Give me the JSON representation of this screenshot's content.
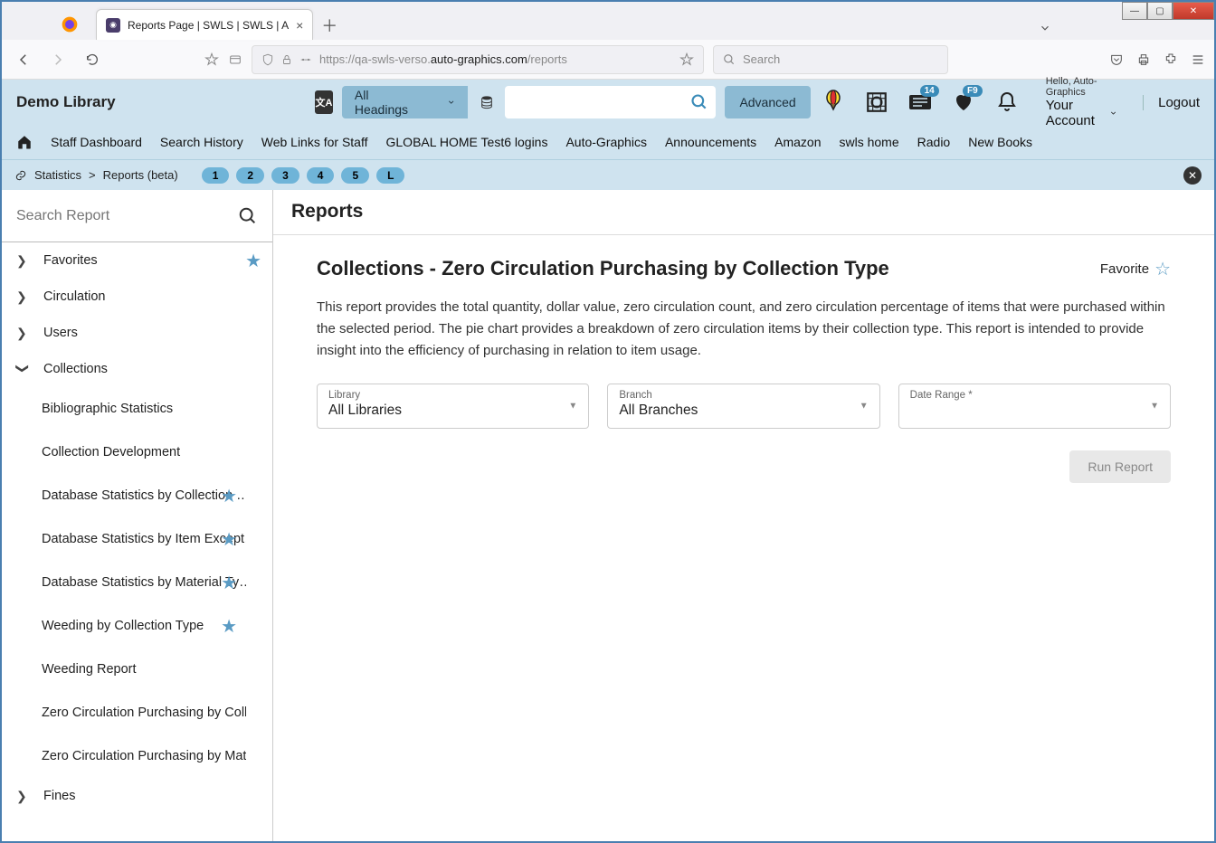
{
  "browser": {
    "tab_title": "Reports Page | SWLS | SWLS | A",
    "url_prefix": "https://qa-swls-verso.",
    "url_host": "auto-graphics.com",
    "url_path": "/reports",
    "search_placeholder": "Search"
  },
  "app": {
    "library_name": "Demo Library",
    "headings_label": "All Headings",
    "advanced_label": "Advanced",
    "account_hello": "Hello, Auto-Graphics",
    "account_label": "Your Account",
    "logout_label": "Logout",
    "badge_messages": "14",
    "badge_fav": "F9"
  },
  "nav": [
    "Staff Dashboard",
    "Search History",
    "Web Links for Staff",
    "GLOBAL HOME Test6 logins",
    "Auto-Graphics",
    "Announcements",
    "Amazon",
    "swls home",
    "Radio",
    "New Books"
  ],
  "breadcrumb": {
    "root": "Statistics",
    "current": "Reports (beta)",
    "pills": [
      "1",
      "2",
      "3",
      "4",
      "5",
      "L"
    ]
  },
  "sidebar": {
    "search_placeholder": "Search Report",
    "sections": {
      "favorites": "Favorites",
      "circulation": "Circulation",
      "users": "Users",
      "collections": "Collections",
      "fines": "Fines"
    },
    "collections_items": [
      {
        "label": "Bibliographic Statistics",
        "star": false
      },
      {
        "label": "Collection Development",
        "star": false
      },
      {
        "label": "Database Statistics by Collection …",
        "star": true
      },
      {
        "label": "Database Statistics by Item Except…",
        "star": true
      },
      {
        "label": "Database Statistics by Material Ty…",
        "star": true
      },
      {
        "label": "Weeding by Collection Type",
        "star": true
      },
      {
        "label": "Weeding Report",
        "star": false
      },
      {
        "label": "Zero Circulation Purchasing by Collect…",
        "star": false
      },
      {
        "label": "Zero Circulation Purchasing by Materi…",
        "star": false
      }
    ]
  },
  "content": {
    "header": "Reports",
    "title": "Collections - Zero Circulation Purchasing by Collection Type",
    "favorite_label": "Favorite",
    "description": "This report provides the total quantity, dollar value, zero circulation count, and zero circulation percentage of items that were purchased within the selected period. The pie chart provides a breakdown of zero circulation items by their collection type. This report is intended to provide insight into the efficiency of purchasing in relation to item usage.",
    "filters": {
      "library": {
        "label": "Library",
        "value": "All Libraries"
      },
      "branch": {
        "label": "Branch",
        "value": "All Branches"
      },
      "daterange": {
        "label": "Date Range",
        "value": ""
      }
    },
    "run_label": "Run Report"
  }
}
